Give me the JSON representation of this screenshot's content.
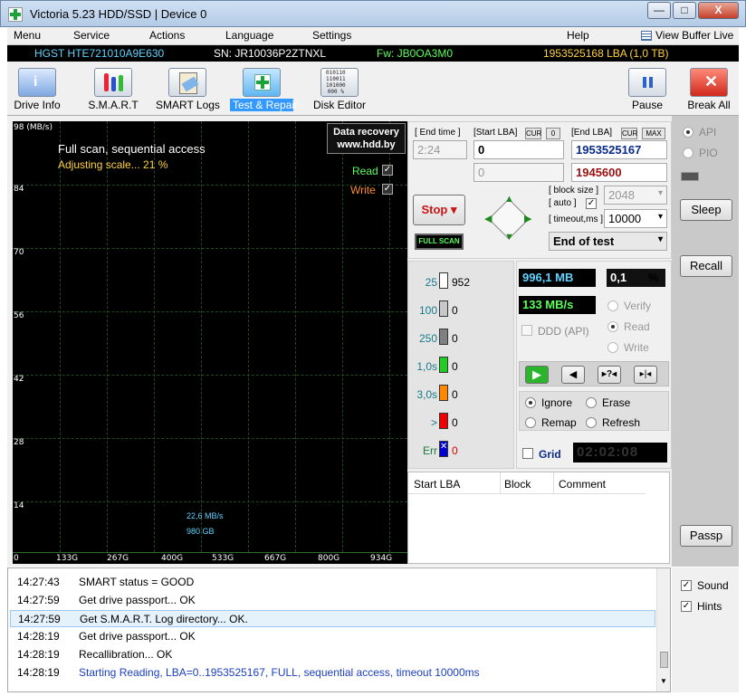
{
  "window": {
    "title": "Victoria 5.23 HDD/SSD | Device 0",
    "min": "—",
    "max": "□",
    "close": "X"
  },
  "menu": {
    "items": [
      "Menu",
      "Service",
      "Actions",
      "Language",
      "Settings",
      "Help"
    ],
    "view_buffer": "View Buffer Live"
  },
  "drive": {
    "model": "HGST HTE721010A9E630",
    "serial": "SN: JR10036P2ZTNXL",
    "firmware": "Fw: JB0OA3M0",
    "capacity": "1953525168 LBA (1,0 TB)"
  },
  "toolbar": {
    "drive_info": "Drive Info",
    "smart": "S.M.A.R.T",
    "smart_logs": "SMART Logs",
    "test_repair": "Test & Repair",
    "disk_editor": "Disk Editor",
    "pause": "Pause",
    "break_all": "Break All",
    "editor_glyph": "010110\n110011\n101000\n000 %"
  },
  "graph": {
    "unit": "98 (MB/s)",
    "title": "Full scan, sequential access",
    "status": "Adjusting scale... 21 %",
    "watermark_line1": "Data recovery",
    "watermark_line2": "www.hdd.by",
    "read_label": "Read",
    "write_label": "Write",
    "speed_readout": "22,6 MB/s",
    "pos_readout": "980 GB",
    "y_ticks": [
      "84",
      "70",
      "56",
      "42",
      "28",
      "14",
      "0"
    ],
    "x_ticks": [
      "133G",
      "267G",
      "400G",
      "533G",
      "667G",
      "800G",
      "934G"
    ]
  },
  "scan": {
    "end_time_label": "[ End time ]",
    "end_time": "2:24",
    "start_lba_label": "[Start LBA]",
    "start_cur": "CUR",
    "start_zero": "0",
    "start_lba": "0",
    "start_lba2": "0",
    "end_lba_label": "[End LBA]",
    "end_cur": "CUR",
    "end_max": "MAX",
    "end_lba": "1953525167",
    "end_lba2": "1945600",
    "stop_label": "Stop",
    "full_scan": "FULL SCAN",
    "block_size_label": "[ block size ]",
    "auto_label": "[ auto ]",
    "block_size": "2048",
    "timeout_label": "[ timeout,ms ]",
    "timeout": "10000",
    "end_action": "End of test"
  },
  "blocks": [
    {
      "label": "25",
      "count": "952",
      "color": "#ffffff"
    },
    {
      "label": "100",
      "count": "0",
      "color": "#c8c8c8"
    },
    {
      "label": "250",
      "count": "0",
      "color": "#808080"
    },
    {
      "label": "1,0s",
      "count": "0",
      "color": "#22cc22"
    },
    {
      "label": "3,0s",
      "count": "0",
      "color": "#ff8800"
    },
    {
      "label": ">",
      "count": "0",
      "color": "#ee0000"
    },
    {
      "label": "Err",
      "count": "0",
      "color": "#0000cc"
    }
  ],
  "stats": {
    "size": "996,1 MB",
    "percent": "0,1",
    "percent_sign": "%",
    "speed": "133 MB/s",
    "ddd": "DDD (API)",
    "verify": "Verify",
    "read": "Read",
    "write": "Write",
    "ignore": "Ignore",
    "erase": "Erase",
    "remap": "Remap",
    "refresh": "Refresh",
    "grid": "Grid",
    "timer": "02:02:08"
  },
  "table": {
    "headers": [
      "Start LBA",
      "Block",
      "Comment"
    ]
  },
  "right": {
    "api": "API",
    "pio": "PIO",
    "sleep": "Sleep",
    "recall": "Recall",
    "passp": "Passp",
    "sound": "Sound",
    "hints": "Hints"
  },
  "log": [
    {
      "time": "14:27:43",
      "msg": "SMART status = GOOD",
      "color": "#000000"
    },
    {
      "time": "14:27:59",
      "msg": "Get drive passport... OK",
      "color": "#000000"
    },
    {
      "time": "14:27:59",
      "msg": "Get S.M.A.R.T. Log directory... OK.",
      "color": "#000000"
    },
    {
      "time": "14:28:19",
      "msg": "Get drive passport... OK",
      "color": "#000000"
    },
    {
      "time": "14:28:19",
      "msg": "Recallibration... OK",
      "color": "#000000"
    },
    {
      "time": "14:28:19",
      "msg": "Starting Reading, LBA=0..1953525167, FULL, sequential access, timeout 10000ms",
      "color": "#1a3fc0"
    }
  ]
}
